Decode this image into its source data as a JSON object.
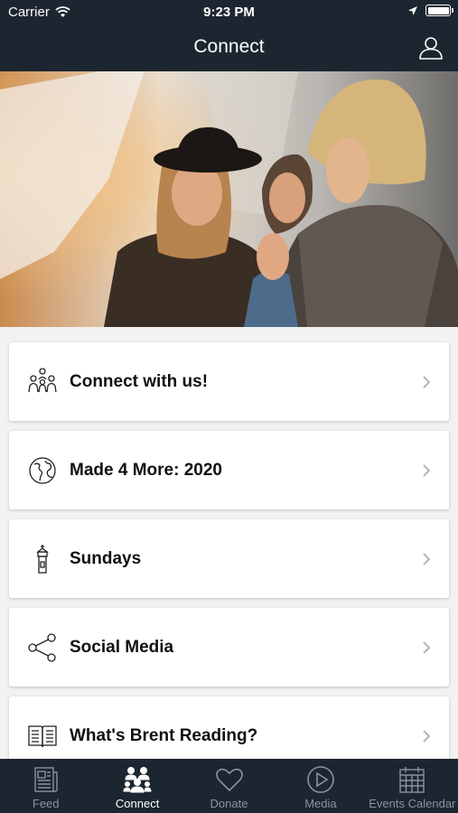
{
  "status": {
    "carrier": "Carrier",
    "time": "9:23 PM"
  },
  "nav": {
    "title": "Connect"
  },
  "items": [
    {
      "label": "Connect with us!",
      "icon": "people-group-icon"
    },
    {
      "label": "Made 4 More: 2020",
      "icon": "globe-icon"
    },
    {
      "label": "Sundays",
      "icon": "steeple-icon"
    },
    {
      "label": "Social Media",
      "icon": "share-icon"
    },
    {
      "label": "What's Brent Reading?",
      "icon": "book-icon"
    }
  ],
  "tabs": [
    {
      "label": "Feed",
      "icon": "newspaper-icon"
    },
    {
      "label": "Connect",
      "icon": "people-group-icon",
      "active": true
    },
    {
      "label": "Donate",
      "icon": "heart-icon"
    },
    {
      "label": "Media",
      "icon": "play-circle-icon"
    },
    {
      "label": "Events Calendar",
      "icon": "calendar-icon"
    }
  ],
  "colors": {
    "bar": "#1c2630",
    "tab_inactive": "#8a939b",
    "tab_active": "#ffffff"
  }
}
